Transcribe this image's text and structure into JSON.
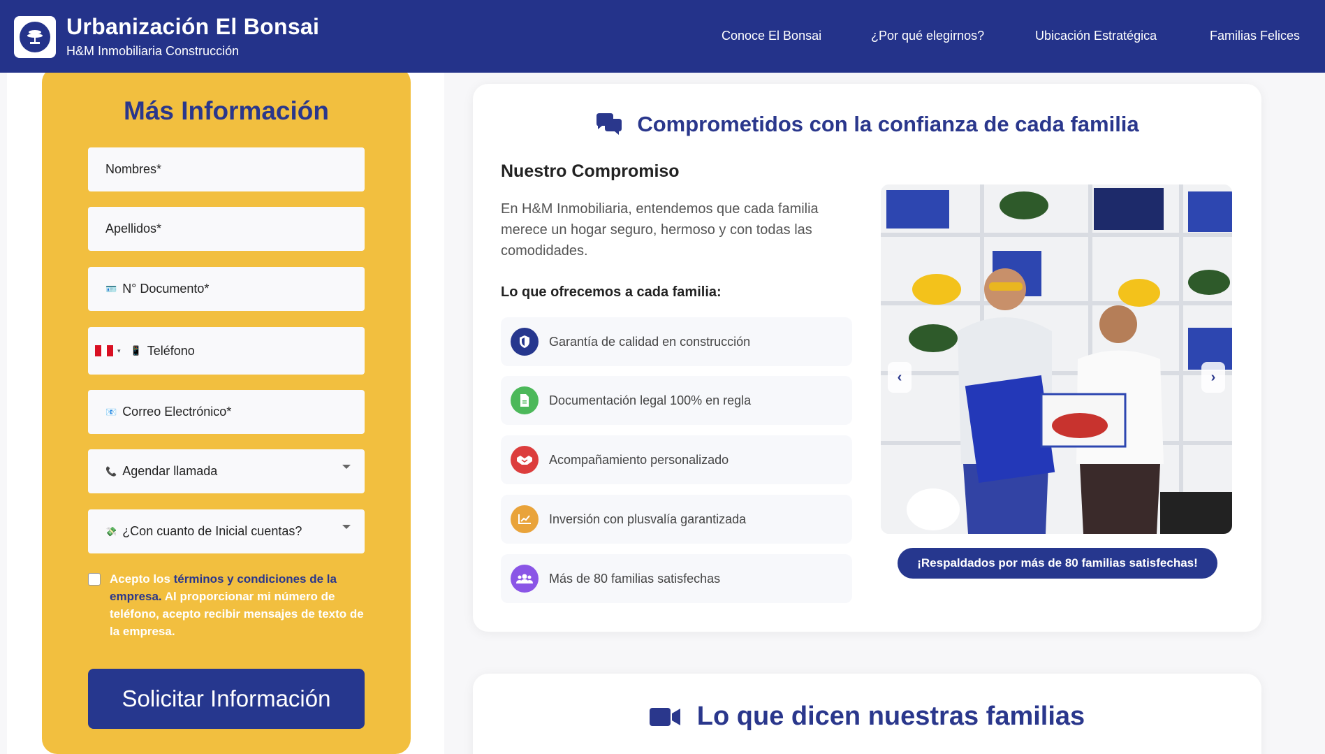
{
  "header": {
    "brand_title": "Urbanización El Bonsai",
    "brand_subtitle": "H&M Inmobiliaria Construcción",
    "nav": [
      "Conoce El Bonsai",
      "¿Por qué elegirnos?",
      "Ubicación Estratégica",
      "Familias Felices"
    ]
  },
  "form": {
    "title": "Más Información",
    "fields": {
      "nombres": "Nombres*",
      "apellidos": "Apellidos*",
      "documento": "N° Documento*",
      "telefono": "Teléfono",
      "correo": "Correo Electrónico*",
      "agendar": "Agendar llamada",
      "inicial": "¿Con cuanto de Inicial cuentas?"
    },
    "terms_prefix": "Acepto los ",
    "terms_link": "términos y condiciones de la empresa.",
    "terms_suffix": " Al proporcionar mi número de teléfono, acepto recibir mensajes de texto de la empresa.",
    "submit": "Solicitar Información"
  },
  "commitment": {
    "title": "Comprometidos con la confianza de cada familia",
    "heading": "Nuestro Compromiso",
    "description": "En H&M Inmobiliaria, entendemos que cada familia merece un hogar seguro, hermoso y con todas las comodidades.",
    "offer_heading": "Lo que ofrecemos a cada familia:",
    "features": [
      {
        "label": "Garantía de calidad en construcción",
        "icon": "shield-icon",
        "color": "#26378e"
      },
      {
        "label": "Documentación legal 100% en regla",
        "icon": "document-icon",
        "color": "#4cb85a"
      },
      {
        "label": "Acompañamiento personalizado",
        "icon": "handshake-icon",
        "color": "#dc3d3d"
      },
      {
        "label": "Inversión con plusvalía garantizada",
        "icon": "chart-line-icon",
        "color": "#e9a33a"
      },
      {
        "label": "Más de 80 familias satisfechas",
        "icon": "users-icon",
        "color": "#8a55e6"
      }
    ],
    "badge": "¡Respaldados por más de 80 familias satisfechas!"
  },
  "testimonials": {
    "title": "Lo que dicen nuestras familias"
  },
  "colors": {
    "primary": "#24338a",
    "accent": "#f2bf3f"
  }
}
